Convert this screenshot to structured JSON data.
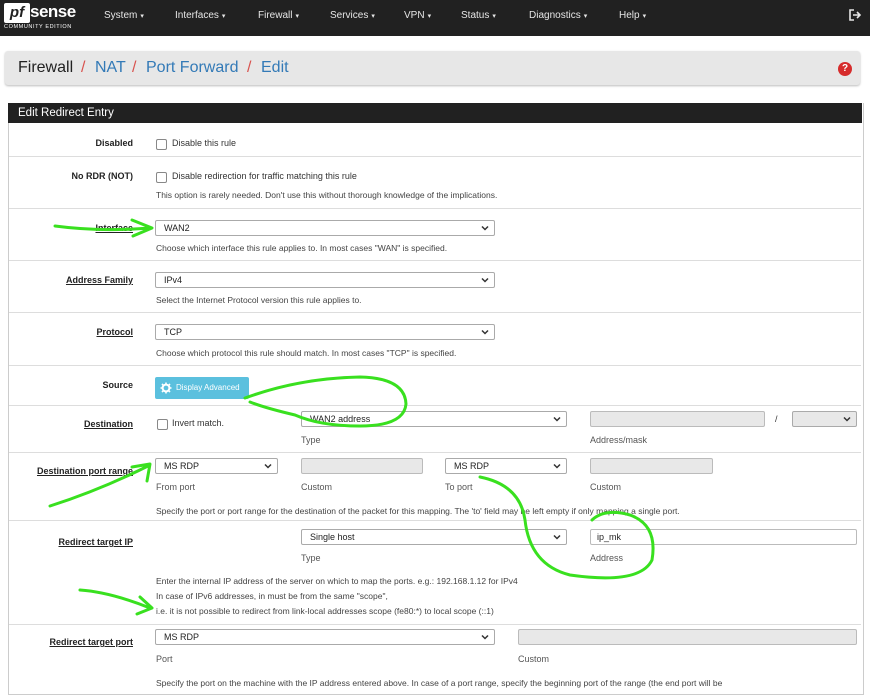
{
  "logo": {
    "box": "pf",
    "word": "sense",
    "sub": "COMMUNITY EDITION"
  },
  "nav": [
    "System",
    "Interfaces",
    "Firewall",
    "Services",
    "VPN",
    "Status",
    "Diagnostics",
    "Help"
  ],
  "breadcrumb": {
    "root": "Firewall",
    "items": [
      "NAT",
      "Port Forward",
      "Edit"
    ],
    "sep": "/"
  },
  "panel_title": "Edit Redirect Entry",
  "disabled": {
    "label": "Disabled",
    "checkbox": "Disable this rule"
  },
  "nordr": {
    "label": "No RDR (NOT)",
    "checkbox": "Disable redirection for traffic matching this rule",
    "help": "This option is rarely needed. Don't use this without thorough knowledge of the implications."
  },
  "interface": {
    "label": "Interface",
    "value": "WAN2",
    "help": "Choose which interface this rule applies to. In most cases \"WAN\" is specified."
  },
  "family": {
    "label": "Address Family",
    "value": "IPv4",
    "help": "Select the Internet Protocol version this rule applies to."
  },
  "protocol": {
    "label": "Protocol",
    "value": "TCP",
    "help": "Choose which protocol this rule should match. In most cases \"TCP\" is specified."
  },
  "source": {
    "label": "Source",
    "button": "Display Advanced"
  },
  "destination": {
    "label": "Destination",
    "invert": "Invert match.",
    "type_value": "WAN2 address",
    "type_label": "Type",
    "mask_sep": "/",
    "addr_label": "Address/mask"
  },
  "dport": {
    "label": "Destination port range",
    "from_value": "MS RDP",
    "from_label": "From port",
    "custom1": "Custom",
    "to_value": "MS RDP",
    "to_label": "To port",
    "custom2": "Custom",
    "help": "Specify the port or port range for the destination of the packet for this mapping. The 'to' field may be left empty if only mapping a single port."
  },
  "target_ip": {
    "label": "Redirect target IP",
    "type_value": "Single host",
    "type_label": "Type",
    "address_value": "ip_mk",
    "address_label": "Address",
    "help1": "Enter the internal IP address of the server on which to map the ports. e.g.: 192.168.1.12 for IPv4",
    "help2": "In case of IPv6 addresses, in must be from the same \"scope\",",
    "help3": "i.e. it is not possible to redirect from link-local addresses scope (fe80:*) to local scope (::1)"
  },
  "target_port": {
    "label": "Redirect target port",
    "value": "MS RDP",
    "port_label": "Port",
    "custom_label": "Custom",
    "help": "Specify the port on the machine with the IP address entered above. In case of a port range, specify the beginning port of the range (the end port will be"
  },
  "colors": {
    "navbar": "#212121",
    "link": "#337ab7",
    "annotation": "#39e01f",
    "info_button": "#5bc0de"
  }
}
